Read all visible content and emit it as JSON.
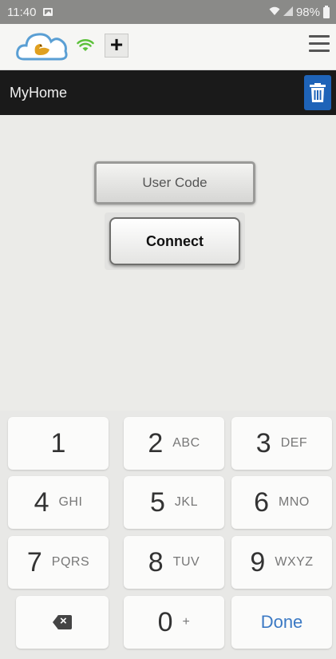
{
  "status_bar": {
    "time": "11:40",
    "battery": "98%",
    "icons": [
      "image-icon",
      "wifi-icon",
      "signal-icon",
      "battery-icon"
    ]
  },
  "header": {
    "plus_label": "+",
    "logo_icon": "cloud-swan-logo",
    "wifi_icon": "wifi-green-icon",
    "menu_icon": "hamburger-menu-icon"
  },
  "title_bar": {
    "title": "MyHome",
    "trash_icon": "trash-icon",
    "accent_color": "#1e63b8"
  },
  "main": {
    "user_code": {
      "placeholder": "User Code",
      "value": ""
    },
    "connect_label": "Connect"
  },
  "keypad": {
    "keys": [
      {
        "digit": "1",
        "letters": ""
      },
      {
        "digit": "2",
        "letters": "ABC"
      },
      {
        "digit": "3",
        "letters": "DEF"
      },
      {
        "digit": "4",
        "letters": "GHI"
      },
      {
        "digit": "5",
        "letters": "JKL"
      },
      {
        "digit": "6",
        "letters": "MNO"
      },
      {
        "digit": "7",
        "letters": "PQRS"
      },
      {
        "digit": "8",
        "letters": "TUV"
      },
      {
        "digit": "9",
        "letters": "WXYZ"
      },
      {
        "digit": "0",
        "letters": "+"
      }
    ],
    "done_label": "Done",
    "done_color": "#3b79c4",
    "backspace_icon": "backspace-icon"
  }
}
